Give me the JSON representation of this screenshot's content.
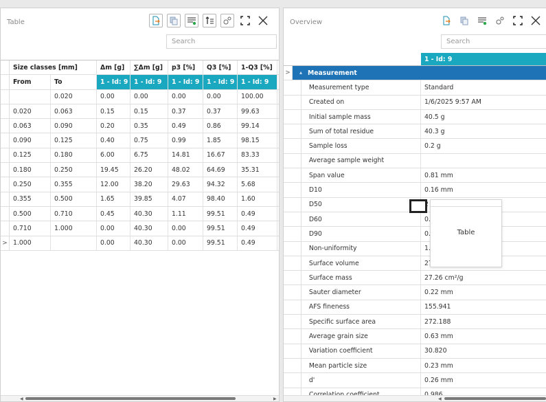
{
  "left": {
    "title": "Table",
    "search_placeholder": "Search",
    "header1": [
      "Size classes [mm]",
      "Δm [g]",
      "∑Δm [g]",
      "p3 [%]",
      "Q3 [%]",
      "1-Q3 [%]"
    ],
    "header2": [
      "From",
      "To",
      "1 - Id: 9",
      "1 - Id: 9",
      "1 - Id: 9",
      "1 - Id: 9",
      "1 - Id: 9"
    ],
    "rows": [
      [
        "",
        "0.020",
        "0.00",
        "0.00",
        "0.00",
        "0.00",
        "100.00"
      ],
      [
        "0.020",
        "0.063",
        "0.15",
        "0.15",
        "0.37",
        "0.37",
        "99.63"
      ],
      [
        "0.063",
        "0.090",
        "0.20",
        "0.35",
        "0.49",
        "0.86",
        "99.14"
      ],
      [
        "0.090",
        "0.125",
        "0.40",
        "0.75",
        "0.99",
        "1.85",
        "98.15"
      ],
      [
        "0.125",
        "0.180",
        "6.00",
        "6.75",
        "14.81",
        "16.67",
        "83.33"
      ],
      [
        "0.180",
        "0.250",
        "19.45",
        "26.20",
        "48.02",
        "64.69",
        "35.31"
      ],
      [
        "0.250",
        "0.355",
        "12.00",
        "38.20",
        "29.63",
        "94.32",
        "5.68"
      ],
      [
        "0.355",
        "0.500",
        "1.65",
        "39.85",
        "4.07",
        "98.40",
        "1.60"
      ],
      [
        "0.500",
        "0.710",
        "0.45",
        "40.30",
        "1.11",
        "99.51",
        "0.49"
      ],
      [
        "0.710",
        "1.000",
        "0.00",
        "40.30",
        "0.00",
        "99.51",
        "0.49"
      ],
      [
        "1.000",
        "",
        "0.00",
        "40.30",
        "0.00",
        "99.51",
        "0.49"
      ]
    ],
    "row_marker": ">"
  },
  "right": {
    "title": "Overview",
    "search_placeholder": "Search",
    "col_tag": "1 - Id: 9",
    "section": "Measurement",
    "expand_marker": ">",
    "props": [
      [
        "Measurement type",
        "Standard"
      ],
      [
        "Created on",
        "1/6/2025 9:57 AM"
      ],
      [
        "Initial sample mass",
        "40.5 g"
      ],
      [
        "Sum of total residue",
        "40.3 g"
      ],
      [
        "Sample loss",
        "0.2 g"
      ],
      [
        "Average sample weight",
        ""
      ],
      [
        "Span value",
        "0.81 mm"
      ],
      [
        "D10",
        "0.16 mm"
      ],
      [
        "D50",
        "2"
      ],
      [
        "D60",
        "0.2"
      ],
      [
        "D90",
        "0.3"
      ],
      [
        "Non-uniformity",
        "1.5"
      ],
      [
        "Surface volume",
        "27."
      ],
      [
        "Surface mass",
        "27.26 cm²/g"
      ],
      [
        "Sauter diameter",
        "0.22 mm"
      ],
      [
        "AFS fineness",
        "155.941"
      ],
      [
        "Specific surface area",
        "272.188"
      ],
      [
        "Average grain size",
        "0.63 mm"
      ],
      [
        "Variation coefficient",
        "30.820"
      ],
      [
        "Mean particle size",
        "0.23 mm"
      ],
      [
        "d'",
        "0.26 mm"
      ],
      [
        "Correlation coefficient",
        "0.986"
      ]
    ]
  },
  "popup": {
    "label": "Table"
  },
  "icons": [
    "export-icon",
    "copy-icon",
    "column-settings-icon",
    "sort-icon",
    "settings-icon",
    "maximize-icon",
    "close-icon"
  ],
  "colors": {
    "accent": "#1aa7c0",
    "section": "#1e72b6"
  }
}
